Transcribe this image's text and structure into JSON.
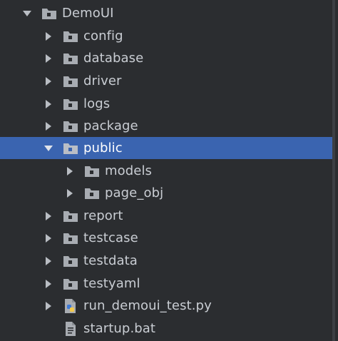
{
  "tree": {
    "root": {
      "label": "DemoUI",
      "icon": "folder-icon",
      "state": "expanded"
    },
    "items": [
      {
        "label": "config",
        "icon": "folder-icon",
        "state": "collapsed"
      },
      {
        "label": "database",
        "icon": "folder-icon",
        "state": "collapsed"
      },
      {
        "label": "driver",
        "icon": "folder-icon",
        "state": "collapsed"
      },
      {
        "label": "logs",
        "icon": "folder-icon",
        "state": "collapsed"
      },
      {
        "label": "package",
        "icon": "folder-icon",
        "state": "collapsed"
      },
      {
        "label": "public",
        "icon": "folder-icon",
        "state": "expanded",
        "selected": true,
        "children": [
          {
            "label": "models",
            "icon": "folder-icon",
            "state": "collapsed"
          },
          {
            "label": "page_obj",
            "icon": "folder-icon",
            "state": "collapsed"
          }
        ]
      },
      {
        "label": "report",
        "icon": "folder-icon",
        "state": "collapsed"
      },
      {
        "label": "testcase",
        "icon": "folder-icon",
        "state": "collapsed"
      },
      {
        "label": "testdata",
        "icon": "folder-icon",
        "state": "collapsed"
      },
      {
        "label": "testyaml",
        "icon": "folder-icon",
        "state": "collapsed"
      },
      {
        "label": "run_demoui_test.py",
        "icon": "python-file-icon",
        "state": "collapsed"
      },
      {
        "label": "startup.bat",
        "icon": "text-file-icon",
        "state": "leaf"
      }
    ]
  },
  "colors": {
    "background": "#2b2d30",
    "selection": "#3a64b0",
    "text": "#c9cdd3",
    "folder": "#a8acb2"
  }
}
